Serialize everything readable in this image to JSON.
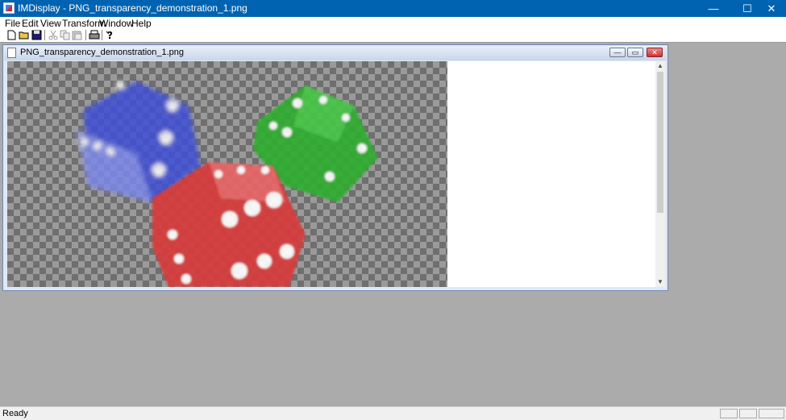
{
  "window": {
    "title": "IMDisplay - PNG_transparency_demonstration_1.png",
    "controls": {
      "minimize": "—",
      "maximize": "☐",
      "close": "✕"
    }
  },
  "menu": [
    "File",
    "Edit",
    "View",
    "Transform",
    "Window",
    "Help"
  ],
  "toolbar": {
    "buttons": [
      {
        "name": "new-file-icon"
      },
      {
        "name": "open-folder-icon"
      },
      {
        "name": "save-disk-icon"
      },
      {
        "name": "cut-icon"
      },
      {
        "name": "copy-icon"
      },
      {
        "name": "paste-icon"
      },
      {
        "name": "print-icon"
      },
      {
        "name": "help-icon"
      }
    ]
  },
  "document": {
    "title": "PNG_transparency_demonstration_1.png",
    "controls": {
      "minimize": "—",
      "restore": "▭",
      "close": "✕"
    }
  },
  "image": {
    "dice": [
      {
        "color": "blue",
        "hex": "#3f4fd6"
      },
      {
        "color": "green",
        "hex": "#2fae2f"
      },
      {
        "color": "red",
        "hex": "#d83a3a"
      }
    ]
  },
  "status": {
    "text": "Ready"
  }
}
